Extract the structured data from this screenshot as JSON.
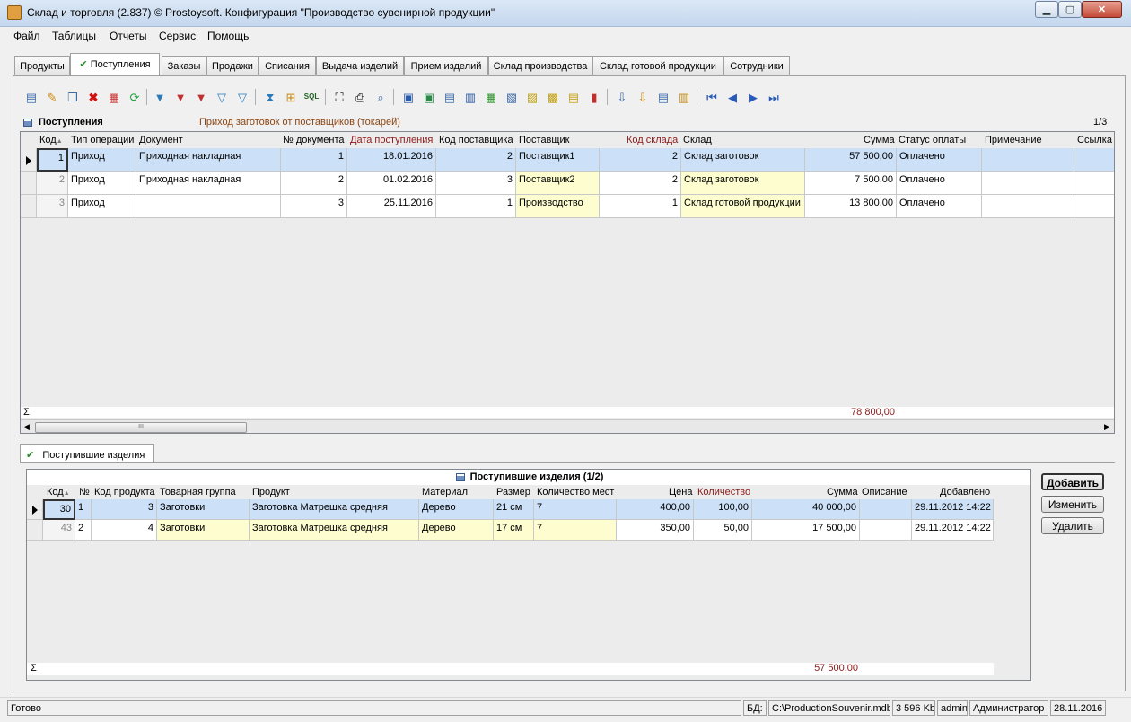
{
  "window": {
    "title": "Склад и торговля (2.837) © Prostoysoft. Конфигурация \"Производство сувенирной продукции\""
  },
  "menu": [
    "Файл",
    "Таблицы",
    "Отчеты",
    "Сервис",
    "Помощь"
  ],
  "tabs": [
    {
      "label": "Продукты",
      "active": false
    },
    {
      "label": "Поступления",
      "active": true,
      "check": "✔"
    },
    {
      "label": "Заказы",
      "active": false
    },
    {
      "label": "Продажи",
      "active": false
    },
    {
      "label": "Списания",
      "active": false
    },
    {
      "label": "Выдача изделий",
      "active": false
    },
    {
      "label": "Прием изделий",
      "active": false
    },
    {
      "label": "Склад производства",
      "active": false
    },
    {
      "label": "Склад готовой продукции",
      "active": false
    },
    {
      "label": "Сотрудники",
      "active": false
    }
  ],
  "toolbar_icons": [
    "add-icon",
    "edit-icon",
    "copy-icon",
    "delete-icon",
    "delete-filtered-icon",
    "refresh-icon",
    "filter-icon",
    "filter-remove-icon",
    "filter-clear-icon",
    "filter-advanced-icon",
    "filter-by-value-icon",
    "tree-filter-icon",
    "group-icon",
    "sql-icon",
    "find-icon",
    "print-icon",
    "preview-icon",
    "export-word-icon",
    "export-excel-icon",
    "export-csv-icon",
    "export-rtf-icon",
    "export-xls-icon",
    "export-xml-icon",
    "export-html-icon",
    "export-txt-icon",
    "export-dbf-icon",
    "chart-icon",
    "import-icon",
    "import-data-icon",
    "fields-icon",
    "columns-icon",
    "first-record-icon",
    "prev-record-icon",
    "next-record-icon",
    "last-record-icon"
  ],
  "grid1": {
    "title": "Поступления",
    "subtitle": "Приход заготовок от поставщиков (токарей)",
    "page": "1/3",
    "columns": [
      "Код",
      "Тип операции",
      "Документ",
      "№ документа",
      "Дата поступления",
      "Код поставщика",
      "Поставщик",
      "Код склада",
      "Склад",
      "Сумма",
      "Статус оплаты",
      "Примечание",
      "Ссылка"
    ],
    "sort_marker": "▲",
    "rows": [
      [
        "1",
        "Приход",
        "Приходная накладная",
        "1",
        "18.01.2016",
        "2",
        "Поставщик1",
        "2",
        "Склад заготовок",
        "57 500,00",
        "Оплачено",
        "",
        ""
      ],
      [
        "2",
        "Приход",
        "Приходная накладная",
        "2",
        "01.02.2016",
        "3",
        "Поставщик2",
        "2",
        "Склад заготовок",
        "7 500,00",
        "Оплачено",
        "",
        ""
      ],
      [
        "3",
        "Приход",
        "",
        "3",
        "25.11.2016",
        "1",
        "Производство",
        "1",
        "Склад готовой продукции",
        "13 800,00",
        "Оплачено",
        "",
        ""
      ]
    ],
    "sigma": "Σ",
    "total": "78 800,00",
    "scroll_grip": "III"
  },
  "bottom_tab": {
    "label": "Поступившие изделия",
    "check": "✔"
  },
  "grid2": {
    "title": "Поступившие изделия (1/2)",
    "columns": [
      "Код",
      "№",
      "Код продукта",
      "Товарная группа",
      "Продукт",
      "Материал",
      "Размер",
      "Количество мест",
      "Цена",
      "Количество",
      "Сумма",
      "Описание",
      "Добавлено"
    ],
    "sort_marker": "▲",
    "rows": [
      [
        "30",
        "1",
        "3",
        "Заготовки",
        "Заготовка Матрешка средняя",
        "Дерево",
        "21 см",
        "7",
        "400,00",
        "100,00",
        "40 000,00",
        "",
        "29.11.2012 14:22"
      ],
      [
        "43",
        "2",
        "4",
        "Заготовки",
        "Заготовка Матрешка средняя",
        "Дерево",
        "17 см",
        "7",
        "350,00",
        "50,00",
        "17 500,00",
        "",
        "29.11.2012 14:22"
      ]
    ],
    "sigma": "Σ",
    "total": "57 500,00"
  },
  "buttons": {
    "add": "Добавить",
    "edit": "Изменить",
    "delete": "Удалить"
  },
  "status": {
    "ready": "Готово",
    "db_label": "БД:",
    "db_path": "C:\\ProductionSouvenir.mdb",
    "size": "3 596 Kb",
    "user": "admin",
    "role": "Администратор",
    "date": "28.11.2016"
  },
  "colors": {
    "selected_row": "#cce0f7",
    "lookup_cell": "#fdfdd0",
    "required_header": "#8b1a1a",
    "subtitle": "#8b4513"
  }
}
